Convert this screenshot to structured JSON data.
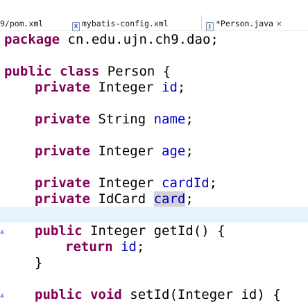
{
  "tabs": [
    {
      "label": "9/pom.xml",
      "icon": "xml-file-icon"
    },
    {
      "label": "mybatis-config.xml",
      "icon": "xml-file-icon"
    },
    {
      "label": "*Person.java",
      "icon": "java-file-icon",
      "active": true
    }
  ],
  "code": {
    "package_kw": "package",
    "package_name": " cn.edu.ujn.ch9.dao;",
    "class_public": "public",
    "class_kw": "class",
    "class_name": " Person {",
    "f1_private": "private",
    "f1_type": " Integer ",
    "f1_name": "id",
    "f1_end": ";",
    "f2_private": "private",
    "f2_type": " String ",
    "f2_name": "name",
    "f2_end": ";",
    "f3_private": "private",
    "f3_type": " Integer ",
    "f3_name": "age",
    "f3_end": ";",
    "f4_private": "private",
    "f4_type": " Integer ",
    "f4_name": "cardId",
    "f4_end": ";",
    "f5_private": "private",
    "f5_type": " IdCard ",
    "f5_name": "card",
    "f5_end": ";",
    "m1_public": "public",
    "m1_sig": " Integer getId() {",
    "m1_return": "return",
    "m1_ret_val": "id",
    "m1_ret_end": ";",
    "m1_close": "}",
    "m2_public": "public",
    "m2_void": "void",
    "m2_sig": " setId(Integer id) {"
  },
  "colors": {
    "keyword": "#7f0055",
    "field": "#0000c0",
    "current_line": "#e8f2fe"
  }
}
